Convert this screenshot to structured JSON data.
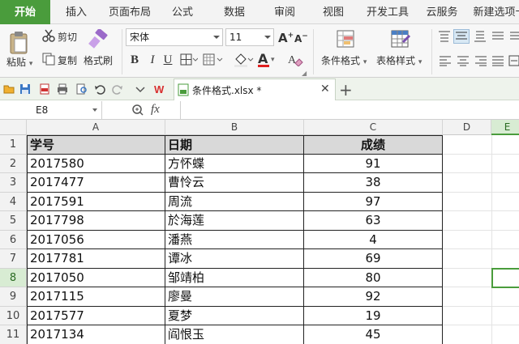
{
  "menu": {
    "tabs": [
      {
        "label": "开始",
        "active": true
      },
      {
        "label": "插入"
      },
      {
        "label": "页面布局"
      },
      {
        "label": "公式"
      },
      {
        "label": "数据"
      },
      {
        "label": "审阅"
      },
      {
        "label": "视图"
      },
      {
        "label": "开发工具"
      },
      {
        "label": "云服务"
      },
      {
        "label": "新建选项卡"
      }
    ]
  },
  "ribbon": {
    "paste": "粘贴",
    "cut": "剪切",
    "copy": "复制",
    "format_painter": "格式刷",
    "font_name": "宋体",
    "font_size": "11",
    "bold": "B",
    "italic": "I",
    "underline": "U",
    "font_color_letter": "A",
    "conditional_format": "条件格式",
    "table_style": "表格样式"
  },
  "quick_access": {
    "doc_name": "条件格式.xlsx *"
  },
  "formula_bar": {
    "name_box": "E8",
    "fx_label": "fx",
    "formula": ""
  },
  "columns": [
    "A",
    "B",
    "C",
    "D",
    "E"
  ],
  "rows": [
    "1",
    "2",
    "3",
    "4",
    "5",
    "6",
    "7",
    "8",
    "9",
    "10",
    "11"
  ],
  "sheet": {
    "headers": [
      "学号",
      "日期",
      "成绩"
    ],
    "records": [
      {
        "id": "2017580",
        "name": "方怀蝶",
        "score": "91"
      },
      {
        "id": "2017477",
        "name": "曹怜云",
        "score": "38"
      },
      {
        "id": "2017591",
        "name": "周流",
        "score": "97"
      },
      {
        "id": "2017798",
        "name": "於海莲",
        "score": "63"
      },
      {
        "id": "2017056",
        "name": "潘燕",
        "score": "4"
      },
      {
        "id": "2017781",
        "name": "谭冰",
        "score": "69"
      },
      {
        "id": "2017050",
        "name": "邹靖柏",
        "score": "80"
      },
      {
        "id": "2017115",
        "name": "廖曼",
        "score": "92"
      },
      {
        "id": "2017577",
        "name": "夏梦",
        "score": "19"
      },
      {
        "id": "2017134",
        "name": "阎恨玉",
        "score": "45"
      }
    ]
  },
  "colors": {
    "accent": "#4a9c3c",
    "header_fill": "#d9d9d9",
    "selected_row_header": "#d8ecd3"
  },
  "selection": {
    "cell": "E8",
    "row": "8"
  }
}
